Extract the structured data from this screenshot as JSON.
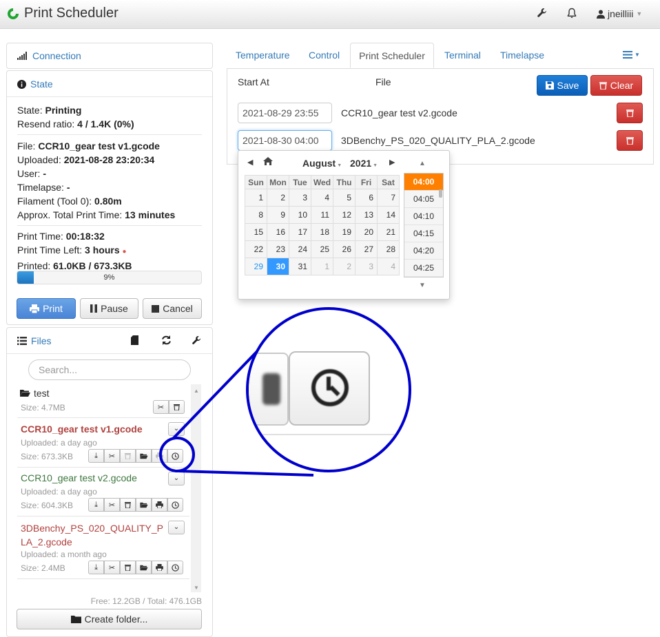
{
  "app": {
    "title": "Print Scheduler",
    "user": "jneilliii"
  },
  "colors": {
    "accent": "#337ab7",
    "brand_green": "#21a532",
    "selected_time": "#ff8000",
    "selected_day": "#3399ff",
    "printing_file": "#b0413e",
    "ok_file": "#3c763d",
    "zoom_circle": "#0000cc"
  },
  "connection": {
    "label": "Connection"
  },
  "state": {
    "label": "State",
    "status_label": "State:",
    "status": "Printing",
    "resend_label": "Resend ratio:",
    "resend": "4 / 1.4K (0%)",
    "file_label": "File:",
    "file": "CCR10_gear test v1.gcode",
    "uploaded_label": "Uploaded:",
    "uploaded": "2021-08-28 23:20:34",
    "user_label": "User:",
    "user": "-",
    "timelapse_label": "Timelapse:",
    "timelapse": "-",
    "filament_label": "Filament (Tool 0):",
    "filament": "0.80m",
    "approx_label": "Approx. Total Print Time:",
    "approx": "13 minutes",
    "print_time_label": "Print Time:",
    "print_time": "00:18:32",
    "time_left_label": "Print Time Left:",
    "time_left": "3 hours",
    "printed_label": "Printed:",
    "printed": "61.0KB / 673.3KB",
    "progress_text": "9%",
    "progress": 0.09,
    "print_btn": "Print",
    "pause_btn": "Pause",
    "cancel_btn": "Cancel"
  },
  "files": {
    "label": "Files",
    "search_placeholder": "Search...",
    "items": [
      {
        "name": "test",
        "size": "Size: 4.7MB"
      },
      {
        "name": "CCR10_gear test v1.gcode",
        "uploaded": "Uploaded: a day ago",
        "size": "Size: 673.3KB"
      },
      {
        "name": "CCR10_gear test v2.gcode",
        "uploaded": "Uploaded: a day ago",
        "size": "Size: 604.3KB"
      },
      {
        "name_line1": "3DBenchy_PS_020_QUALITY_P",
        "name_line2": "LA_2.gcode",
        "uploaded": "Uploaded: a month ago",
        "size": "Size: 2.4MB"
      }
    ],
    "free": "Free: 12.2GB / Total: 476.1GB",
    "create_folder": "Create folder..."
  },
  "tabs": [
    "Temperature",
    "Control",
    "Print Scheduler",
    "Terminal",
    "Timelapse"
  ],
  "scheduler": {
    "col_start": "Start At",
    "col_file": "File",
    "save": "Save",
    "clear": "Clear",
    "rows": [
      {
        "start": "2021-08-29 23:55",
        "file": "CCR10_gear test v2.gcode"
      },
      {
        "start": "2021-08-30 04:00",
        "file": "3DBenchy_PS_020_QUALITY_PLA_2.gcode"
      }
    ]
  },
  "datepicker": {
    "month": "August",
    "year": "2021",
    "weekdays": [
      "Sun",
      "Mon",
      "Tue",
      "Wed",
      "Thu",
      "Fri",
      "Sat"
    ],
    "weeks": [
      [
        "1",
        "2",
        "3",
        "4",
        "5",
        "6",
        "7"
      ],
      [
        "8",
        "9",
        "10",
        "11",
        "12",
        "13",
        "14"
      ],
      [
        "15",
        "16",
        "17",
        "18",
        "19",
        "20",
        "21"
      ],
      [
        "22",
        "23",
        "24",
        "25",
        "26",
        "27",
        "28"
      ],
      [
        "29",
        "30",
        "31",
        "1",
        "2",
        "3",
        "4"
      ]
    ],
    "selected_day": "30",
    "times": [
      "04:00",
      "04:05",
      "04:10",
      "04:15",
      "04:20",
      "04:25"
    ],
    "selected_time": "04:00"
  }
}
